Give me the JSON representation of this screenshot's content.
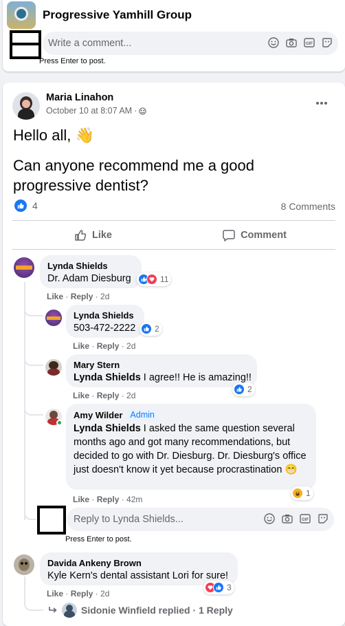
{
  "group": {
    "name": "Progressive Yamhill Group"
  },
  "top_comment_box": {
    "placeholder": "Write a comment...",
    "hint": "Press Enter to post."
  },
  "post": {
    "author": "Maria Linahon",
    "timestamp": "October 10 at 8:07 AM",
    "privacy_icon": "group-icon",
    "greeting": "Hello all,",
    "greeting_emoji": "👋",
    "question": "Can anyone recommend me a good progressive dentist?",
    "like_count": "4",
    "comments_count": "8 Comments",
    "actions": {
      "like": "Like",
      "comment": "Comment"
    }
  },
  "comments": [
    {
      "name": "Lynda Shields",
      "text": "Dr. Adam Diesburg",
      "like": "Like",
      "reply": "Reply",
      "time": "2d",
      "reactions": "11"
    },
    {
      "name": "Lynda Shields",
      "text": "503-472-2222",
      "like": "Like",
      "reply": "Reply",
      "time": "2d",
      "reactions": "2"
    },
    {
      "name": "Mary Stern",
      "mention": "Lynda Shields",
      "text": " I agree!! He is amazing!!",
      "like": "Like",
      "reply": "Reply",
      "time": "2d",
      "reactions": "2"
    },
    {
      "name": "Amy Wilder",
      "badge": "Admin",
      "mention": "Lynda Shields",
      "text": " I asked the same question several months ago and got many recommendations, but decided to go with Dr. Diesburg. Dr. Diesburg's office just doesn't know it yet because procrastination",
      "emoji": "😁",
      "like": "Like",
      "reply": "Reply",
      "time": "42m",
      "reactions": "1"
    },
    {
      "name": "Davida Ankeny Brown",
      "text": "Kyle Kern's dental assistant Lori for sure!",
      "like": "Like",
      "reply": "Reply",
      "time": "2d",
      "reactions": "3"
    }
  ],
  "reply_box": {
    "placeholder": "Reply to Lynda Shields...",
    "hint": "Press Enter to post."
  },
  "replies_link": {
    "name": "Sidonie Winfield",
    "text": " replied · 1 Reply"
  },
  "colors": {
    "like_blue": "#1877f2",
    "love_red": "#f33e58",
    "haha_yellow": "#f7b125",
    "admin_bg": "#e7f3ff"
  }
}
